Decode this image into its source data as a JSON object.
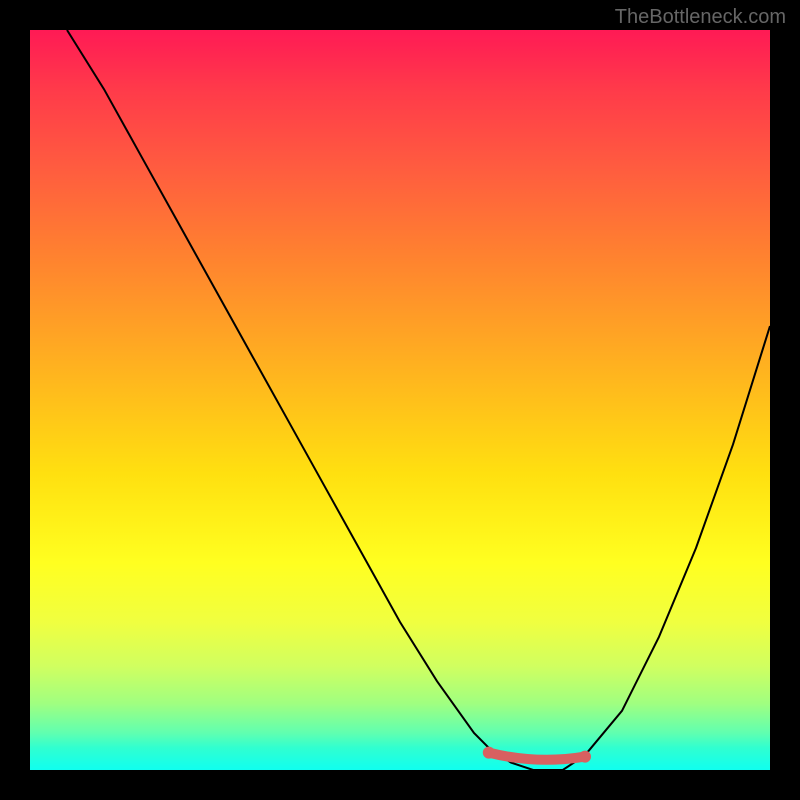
{
  "watermark": "TheBottleneck.com",
  "chart_data": {
    "type": "line",
    "title": "",
    "xlabel": "",
    "ylabel": "",
    "xlim": [
      0,
      100
    ],
    "ylim": [
      0,
      100
    ],
    "grid": false,
    "background_gradient": {
      "top": "#ff1a55",
      "mid": "#ffff20",
      "bottom": "#10ffef"
    },
    "series": [
      {
        "name": "bottleneck-curve",
        "color": "#000000",
        "x": [
          5,
          10,
          15,
          20,
          25,
          30,
          35,
          40,
          45,
          50,
          55,
          60,
          62,
          65,
          68,
          72,
          75,
          80,
          85,
          90,
          95,
          100
        ],
        "y": [
          100,
          92,
          83,
          74,
          65,
          56,
          47,
          38,
          29,
          20,
          12,
          5,
          3,
          1,
          0,
          0,
          2,
          8,
          18,
          30,
          44,
          60
        ]
      }
    ],
    "highlight_range": {
      "name": "optimal-range",
      "color": "#d86060",
      "x_start": 62,
      "x_end": 75,
      "y": 1
    },
    "annotations": []
  }
}
